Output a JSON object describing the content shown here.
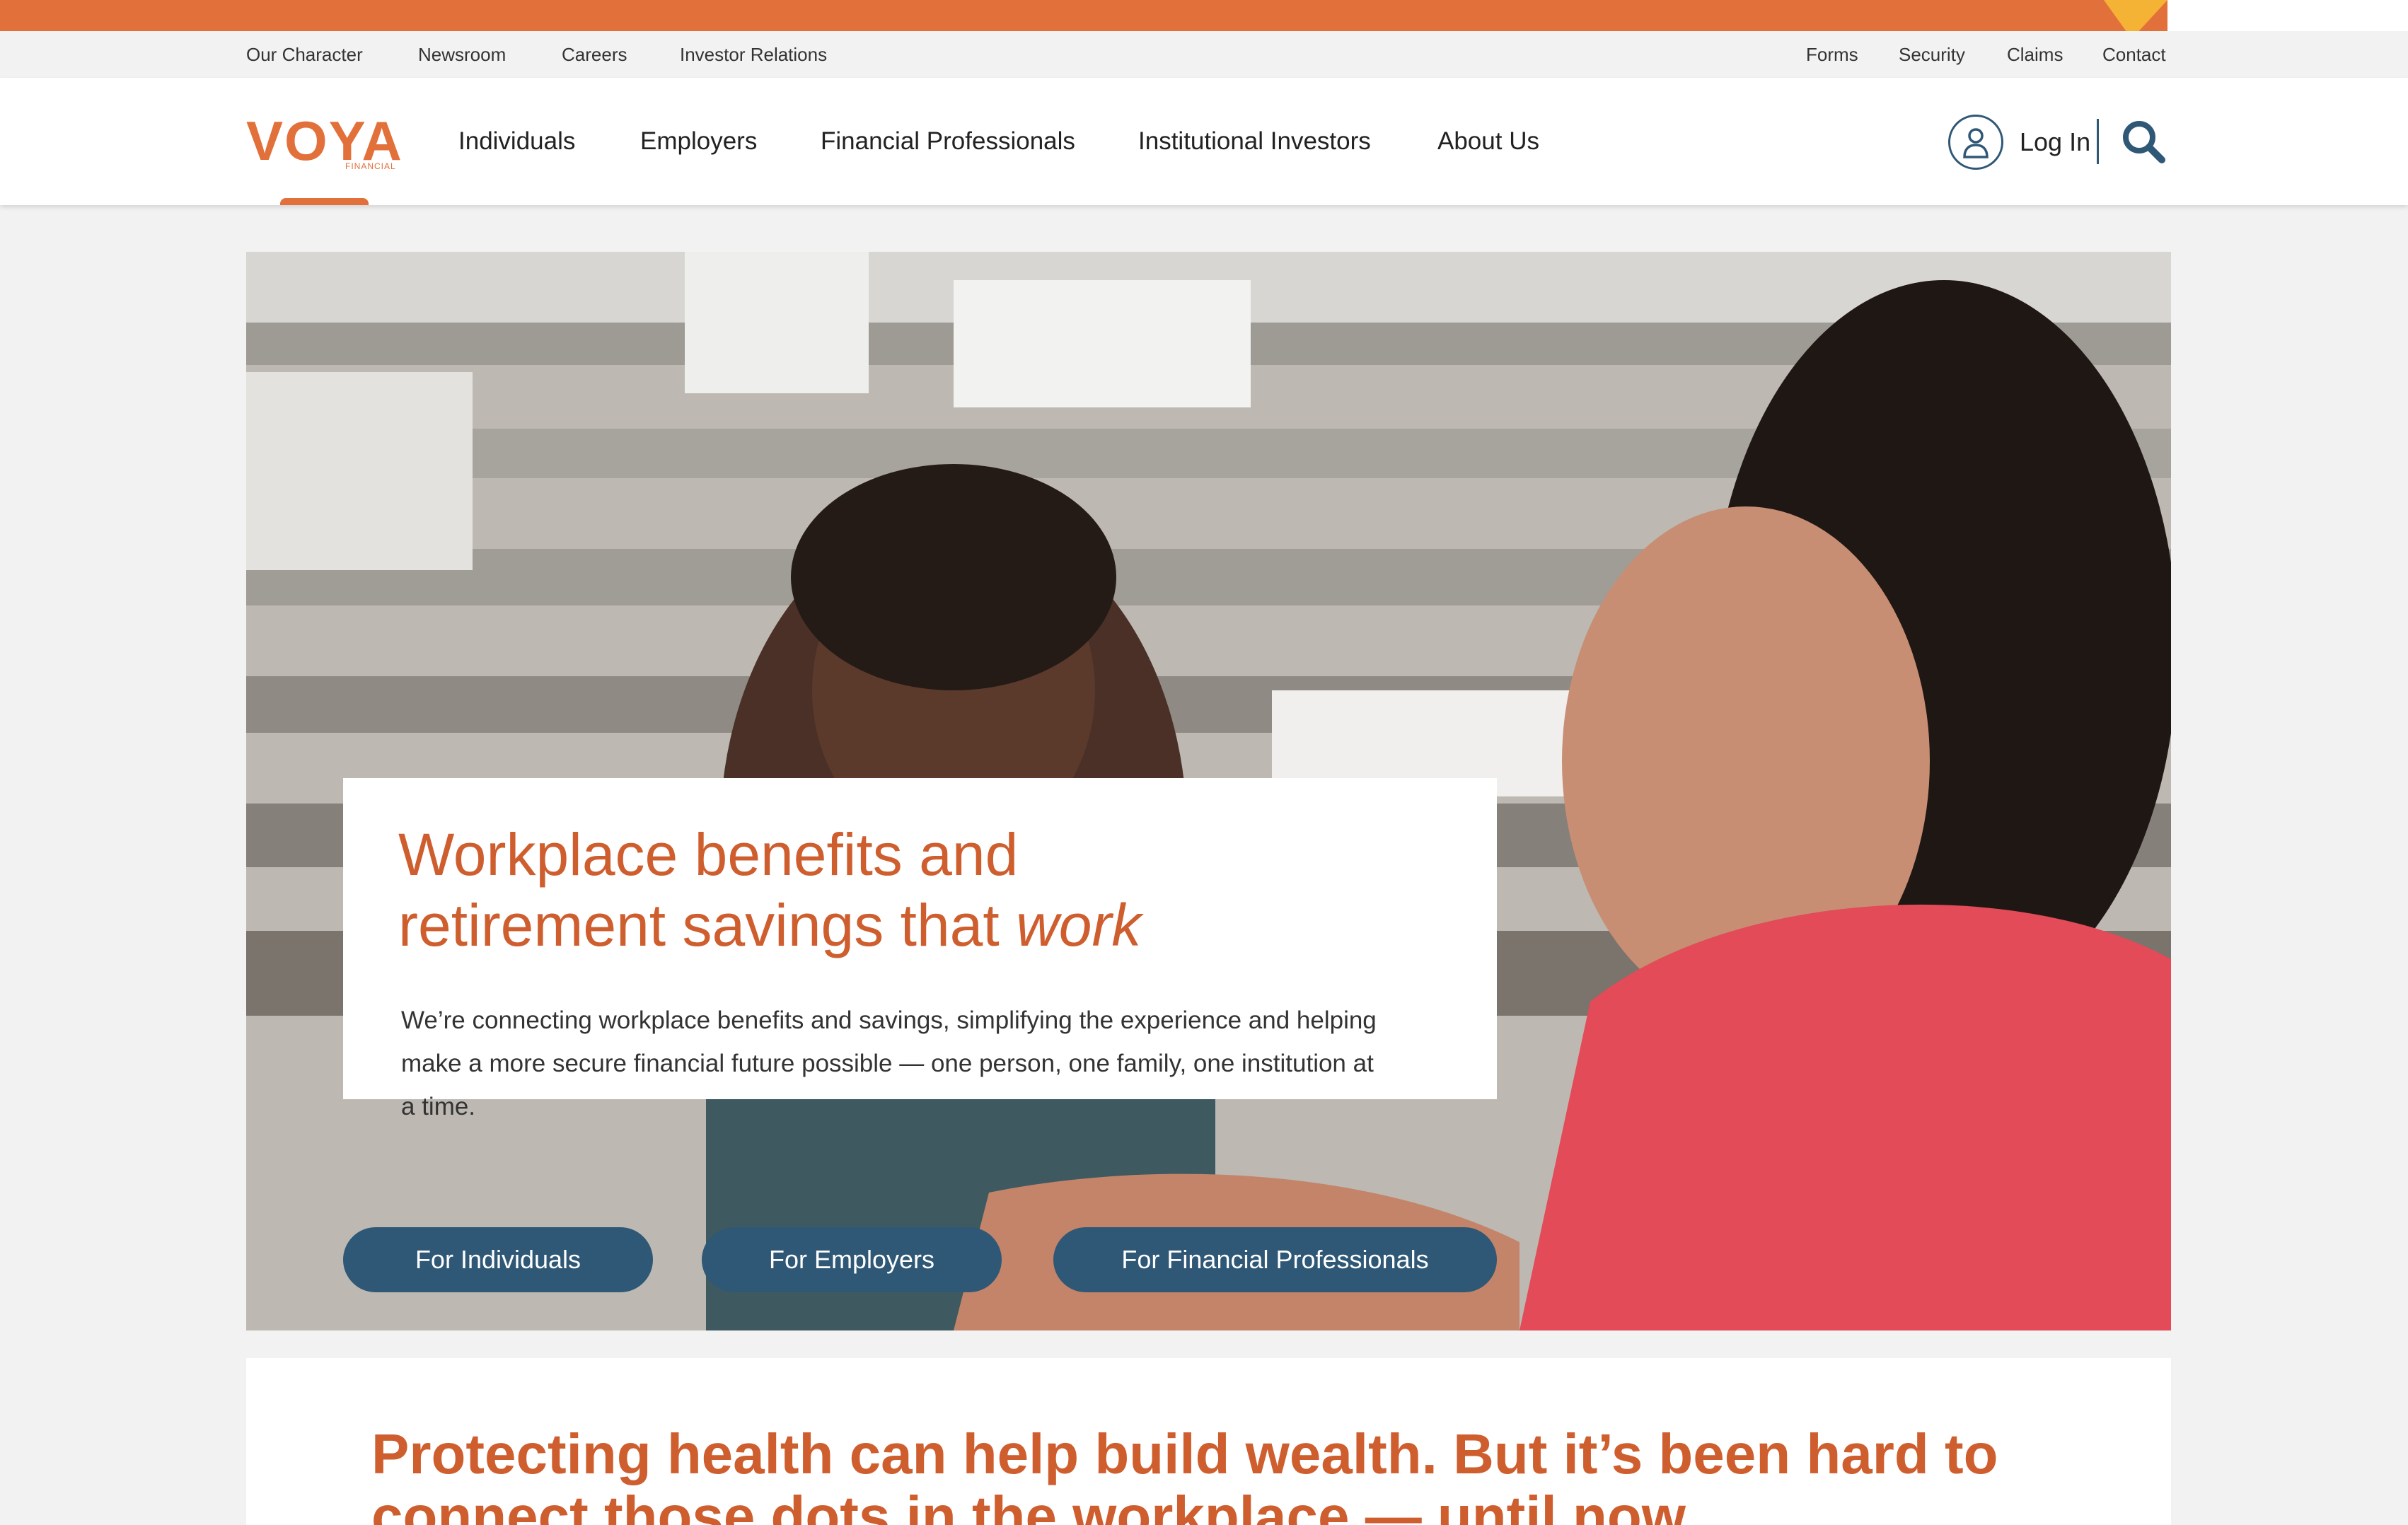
{
  "utility_nav": {
    "left": [
      "Our Character",
      "Newsroom",
      "Careers",
      "Investor Relations"
    ],
    "right": [
      "Forms",
      "Security",
      "Claims",
      "Contact"
    ]
  },
  "brand": {
    "name": "VOYA",
    "sub": "FINANCIAL"
  },
  "main_nav": {
    "items": [
      "Individuals",
      "Employers",
      "Financial Professionals",
      "Institutional Investors",
      "About Us"
    ],
    "login_label": "Log In"
  },
  "hero": {
    "title_line1": "Workplace benefits and",
    "title_line2_plain": "retirement savings that ",
    "title_line2_emphasis": "work",
    "description": "We’re connecting workplace benefits and savings, simplifying the experience and helping make a more secure financial future possible — one person, one family, one institution at a time.",
    "buttons": [
      "For Individuals",
      "For Employers",
      "For Financial Professionals"
    ]
  },
  "section2": {
    "heading": "Protecting health can help build wealth. But it’s been hard to connect those dots in the workplace — until now."
  },
  "colors": {
    "brand_orange": "#e2703a",
    "heading_orange": "#cf5e2f",
    "button_navy": "#2f5876",
    "accent_yellow": "#f5b335"
  }
}
